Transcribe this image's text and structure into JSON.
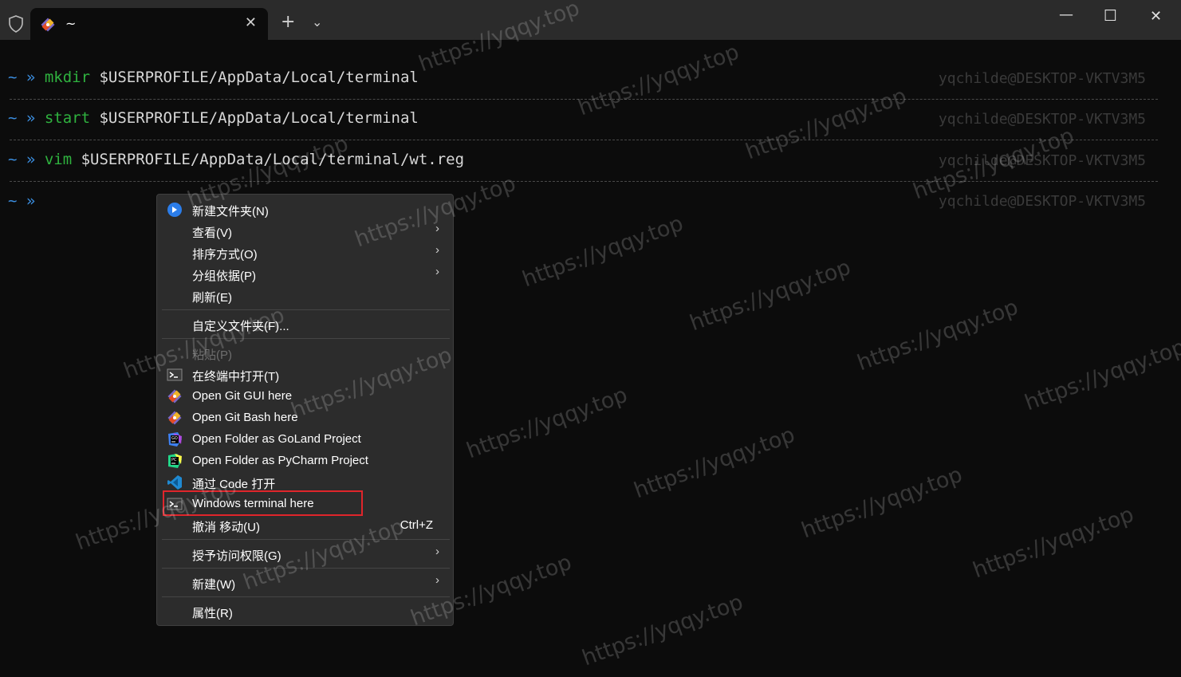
{
  "tab": {
    "title": "~",
    "icon": "git-icon"
  },
  "window_controls": {
    "new_tab": "+",
    "dropdown": "⌄",
    "minimize": "—",
    "maximize": "☐",
    "close": "✕",
    "tab_close": "✕"
  },
  "terminal": {
    "prompt_tilde": "~",
    "prompt_chevron": "»",
    "host": "yqchilde@DESKTOP-VKTV3M5",
    "lines": [
      {
        "cmd": "mkdir",
        "arg": " $USERPROFILE/AppData/Local/terminal"
      },
      {
        "cmd": "start",
        "arg": " $USERPROFILE/AppData/Local/terminal"
      },
      {
        "cmd": "vim",
        "arg": " $USERPROFILE/AppData/Local/terminal/wt.reg"
      }
    ]
  },
  "context_menu": {
    "items": [
      {
        "label": "新建文件夹(N)",
        "icon": "new-folder-icon"
      },
      {
        "label": "查看(V)",
        "submenu": true
      },
      {
        "label": "排序方式(O)",
        "submenu": true
      },
      {
        "label": "分组依据(P)",
        "submenu": true
      },
      {
        "label": "刷新(E)"
      },
      {
        "label": "自定义文件夹(F)..."
      },
      {
        "label": "粘贴(P)",
        "disabled": true
      },
      {
        "label": "在终端中打开(T)",
        "icon": "terminal-icon"
      },
      {
        "label": "Open Git GUI here",
        "icon": "git-icon"
      },
      {
        "label": "Open Git Bash here",
        "icon": "git-icon"
      },
      {
        "label": "Open Folder as GoLand Project",
        "icon": "goland-icon"
      },
      {
        "label": "Open Folder as PyCharm Project",
        "icon": "pycharm-icon"
      },
      {
        "label": "通过 Code 打开",
        "icon": "vscode-icon"
      },
      {
        "label": "Windows terminal here",
        "icon": "terminal-icon",
        "highlighted": true
      },
      {
        "label": "撤消 移动(U)",
        "shortcut": "Ctrl+Z"
      },
      {
        "label": "授予访问权限(G)",
        "submenu": true
      },
      {
        "label": "新建(W)",
        "submenu": true
      },
      {
        "label": "属性(R)"
      }
    ],
    "submenu_arrow": "›"
  },
  "watermark": "https://yqqy.top",
  "colors": {
    "highlight_box": "#e0252b",
    "prompt": "#3b8ee0",
    "command": "#2fb23f"
  }
}
